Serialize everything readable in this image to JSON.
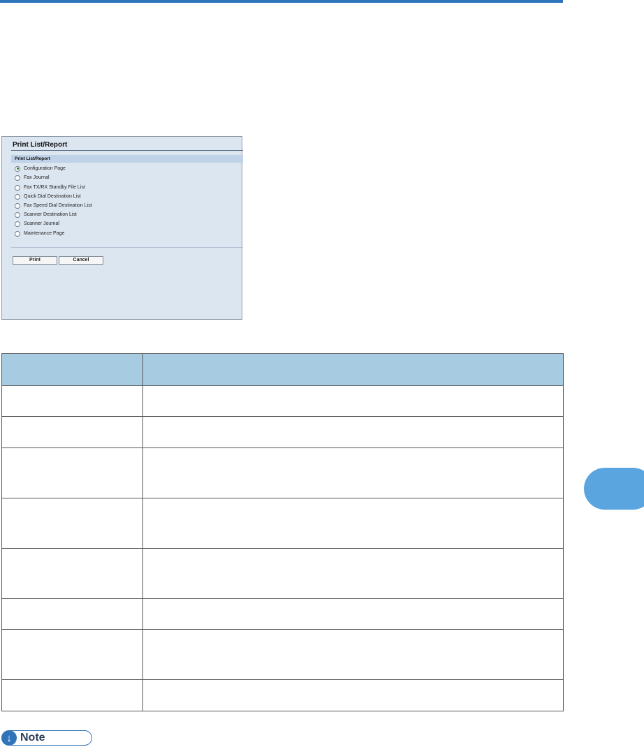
{
  "screenshot": {
    "title": "Print List/Report",
    "section_header": "Print List/Report",
    "options": [
      {
        "label": "Configuration Page",
        "checked": true
      },
      {
        "label": "Fax Journal",
        "checked": false
      },
      {
        "label": "Fax TX/RX Standby File List",
        "checked": false
      },
      {
        "label": "Quick Dial Destination List",
        "checked": false
      },
      {
        "label": "Fax Speed Dial Destination List",
        "checked": false
      },
      {
        "label": "Scanner Destination List",
        "checked": false
      },
      {
        "label": "Scanner Journal",
        "checked": false
      },
      {
        "label": "Maintenance Page",
        "checked": false
      }
    ],
    "print_button": "Print",
    "cancel_button": "Cancel"
  },
  "table": {
    "header": [
      "",
      ""
    ],
    "rows": [
      [
        "",
        ""
      ],
      [
        "",
        ""
      ],
      [
        "",
        ""
      ],
      [
        "",
        ""
      ],
      [
        "",
        ""
      ],
      [
        "",
        ""
      ],
      [
        "",
        ""
      ],
      [
        "",
        ""
      ]
    ]
  },
  "note": {
    "label": "Note",
    "icon": "down-arrow-icon"
  },
  "colors": {
    "accent": "#2f73b8",
    "table_header": "#a7cbe0",
    "side_tab": "#5aa5e0"
  }
}
